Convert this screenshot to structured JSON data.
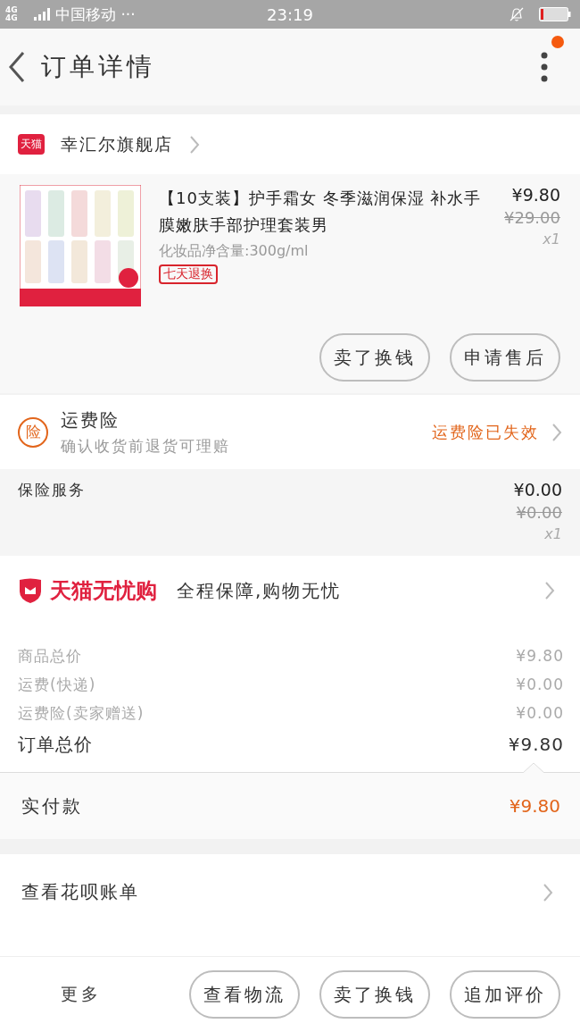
{
  "status_bar": {
    "network": "4G 4G",
    "carrier": "中国移动 ···",
    "time": "23:19"
  },
  "header": {
    "title": "订单详情",
    "has_notification": true
  },
  "store": {
    "name": "幸汇尔旗舰店",
    "badge": "天猫"
  },
  "product": {
    "title": "【10支装】护手霜女 冬季滋润保湿 补水手膜嫩肤手部护理套装男",
    "spec": "化妆品净含量:300g/ml",
    "tag": "七天退换",
    "price": "¥9.80",
    "original_price": "¥29.00",
    "quantity": "x1"
  },
  "product_actions": [
    "卖了换钱",
    "申请售后"
  ],
  "shipping_insurance": {
    "icon_text": "险",
    "title": "运费险",
    "subtitle": "确认收货前退货可理赔",
    "status": "运费险已失效"
  },
  "insurance_service": {
    "label": "保险服务",
    "price": "¥0.00",
    "original_price": "¥0.00",
    "quantity": "x1"
  },
  "guarantee": {
    "brand": "天猫无忧购",
    "text": "全程保障,购物无忧"
  },
  "costs": [
    {
      "label": "商品总价",
      "value": "¥9.80",
      "kind": "minor"
    },
    {
      "label": "运费(快递)",
      "value": "¥0.00",
      "kind": "minor"
    },
    {
      "label": "运费险(卖家赠送)",
      "value": "¥0.00",
      "kind": "minor"
    },
    {
      "label": "订单总价",
      "value": "¥9.80",
      "kind": "total"
    }
  ],
  "payment": {
    "label": "实付款",
    "value": "¥9.80"
  },
  "huabei": {
    "label": "查看花呗账单"
  },
  "bottom_bar": {
    "more": "更多",
    "buttons": [
      "查看物流",
      "卖了换钱",
      "追加评价"
    ]
  }
}
